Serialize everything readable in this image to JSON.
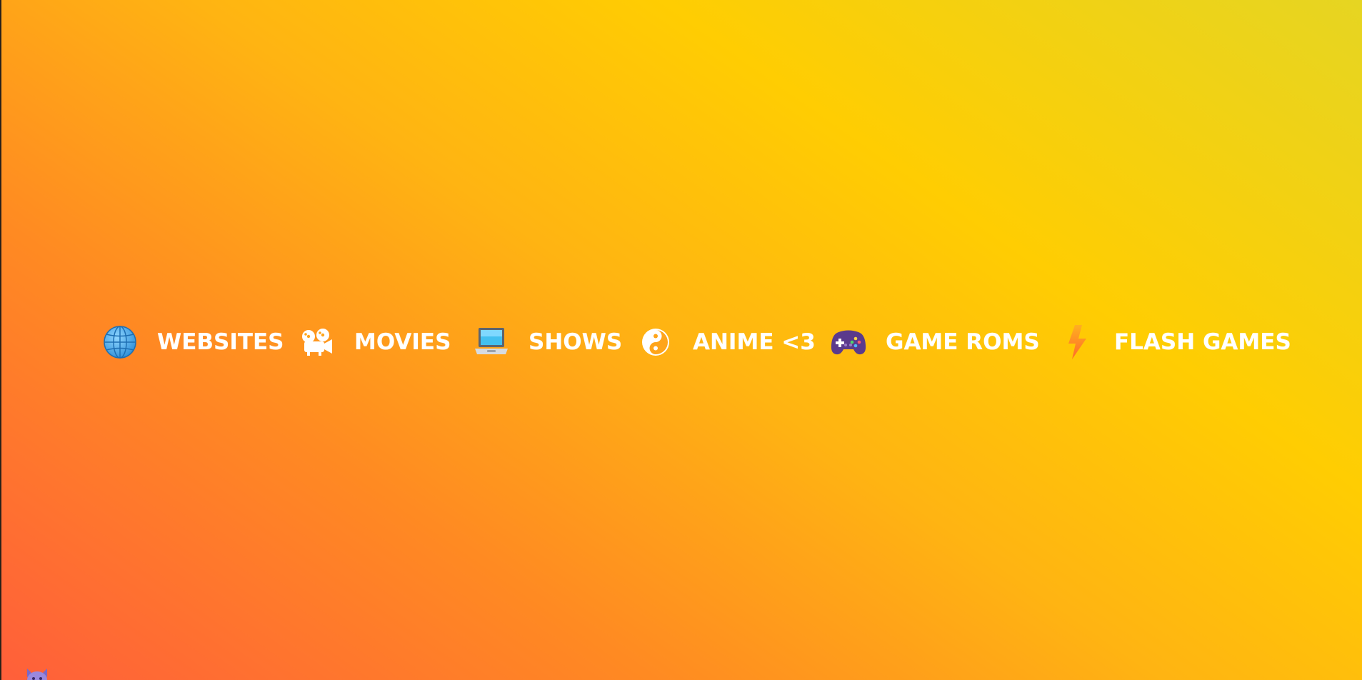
{
  "nav": {
    "items": [
      {
        "icon": "globe-icon",
        "label": "WEBSITES"
      },
      {
        "icon": "film-projector-icon",
        "label": "MOVIES"
      },
      {
        "icon": "laptop-icon",
        "label": "SHOWS"
      },
      {
        "icon": "yin-yang-icon",
        "label": "ANIME <3"
      },
      {
        "icon": "game-controller-icon",
        "label": "GAME ROMS"
      },
      {
        "icon": "lightning-bolt-icon",
        "label": "FLASH GAMES"
      }
    ]
  },
  "corner": {
    "icon": "cat-mascot-icon"
  },
  "colors": {
    "gradient_start": "#ff5f3a",
    "gradient_mid": "#ffb412",
    "gradient_end": "#e6d522",
    "label": "#ffffff"
  }
}
